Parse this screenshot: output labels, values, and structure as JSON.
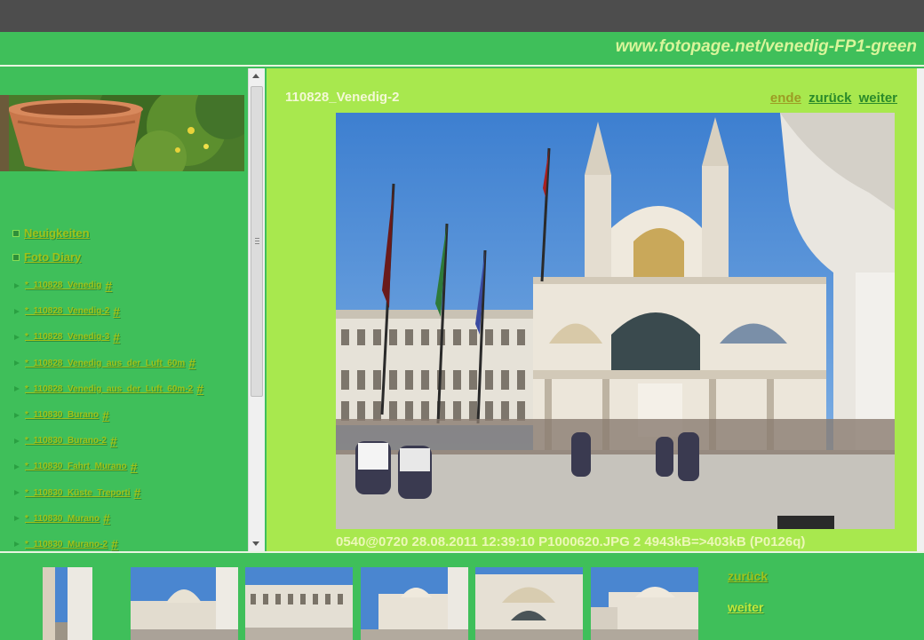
{
  "header": {
    "site_url": "www.fotopage.net/venedig-FP1-green"
  },
  "sidebar": {
    "main_items": [
      {
        "label": "Neuigkeiten"
      },
      {
        "label": "Foto Diary"
      }
    ],
    "sub_items": [
      {
        "label": "* 110828_Venedig",
        "hash": "#"
      },
      {
        "label": "* 110828_Venedig-2",
        "hash": "#"
      },
      {
        "label": "* 110828_Venedig-3",
        "hash": "#"
      },
      {
        "label": "* 110828_Venedig_aus_der_Luft_60m",
        "hash": "#"
      },
      {
        "label": "* 110828_Venedig_aus_der_Luft_60m-2",
        "hash": "#"
      },
      {
        "label": "* 110830_Burano",
        "hash": "#"
      },
      {
        "label": "* 110830_Burano-2",
        "hash": "#"
      },
      {
        "label": "* 110830_Fahrt_Murano",
        "hash": "#"
      },
      {
        "label": "* 110830_Küste_Treporti",
        "hash": "#"
      },
      {
        "label": "* 110830_Murano",
        "hash": "#"
      },
      {
        "label": "* 110830_Murano-2",
        "hash": "#"
      }
    ]
  },
  "main": {
    "title": "110828_Venedig-2",
    "pager": {
      "end": "ende",
      "back": "zurück",
      "next": "weiter"
    },
    "caption": "0540@0720 28.08.2011 12:39:10 P1000620.JPG 2 4943kB=>403kB (P0126q)"
  },
  "filmstrip": {
    "back": "zurück",
    "next": "weiter"
  },
  "colors": {
    "page_green": "#3fbf5a",
    "panel_lime": "#a8e84e",
    "link_olive": "#a0c21a",
    "topbar_gray": "#4d4d4d"
  }
}
